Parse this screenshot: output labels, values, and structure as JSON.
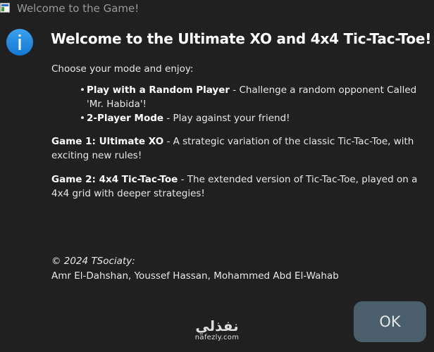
{
  "window": {
    "title": "Welcome to the Game!",
    "icon": "app-icon"
  },
  "dialog": {
    "icon": "info-icon",
    "heading": "Welcome to the Ultimate XO and 4x4 Tic-Tac-Toe!",
    "intro": "Choose your mode and enjoy:",
    "modes": [
      {
        "name": "Play with a Random Player",
        "description": " - Challenge a random opponent Called 'Mr. Habida'!"
      },
      {
        "name": "2-Player Mode",
        "description": " - Play against your friend!"
      }
    ],
    "games": [
      {
        "name": "Game 1: Ultimate XO",
        "description": " - A strategic variation of the classic Tic-Tac-Toe, with exciting new rules!"
      },
      {
        "name": "Game 2: 4x4 Tic-Tac-Toe",
        "description": " - The extended version of Tic-Tac-Toe, played on a 4x4 grid with deeper strategies!"
      }
    ],
    "copyright": "© 2024 TSociaty:",
    "authors": "Amr El-Dahshan, Youssef Hassan, Mohammed Abd El-Wahab",
    "ok_label": "OK"
  },
  "watermark": {
    "main": "نفذلي",
    "sub": "nafezly.com"
  },
  "colors": {
    "background": "#202020",
    "button": "#4a5f6b",
    "info_icon": "#1d86de"
  }
}
